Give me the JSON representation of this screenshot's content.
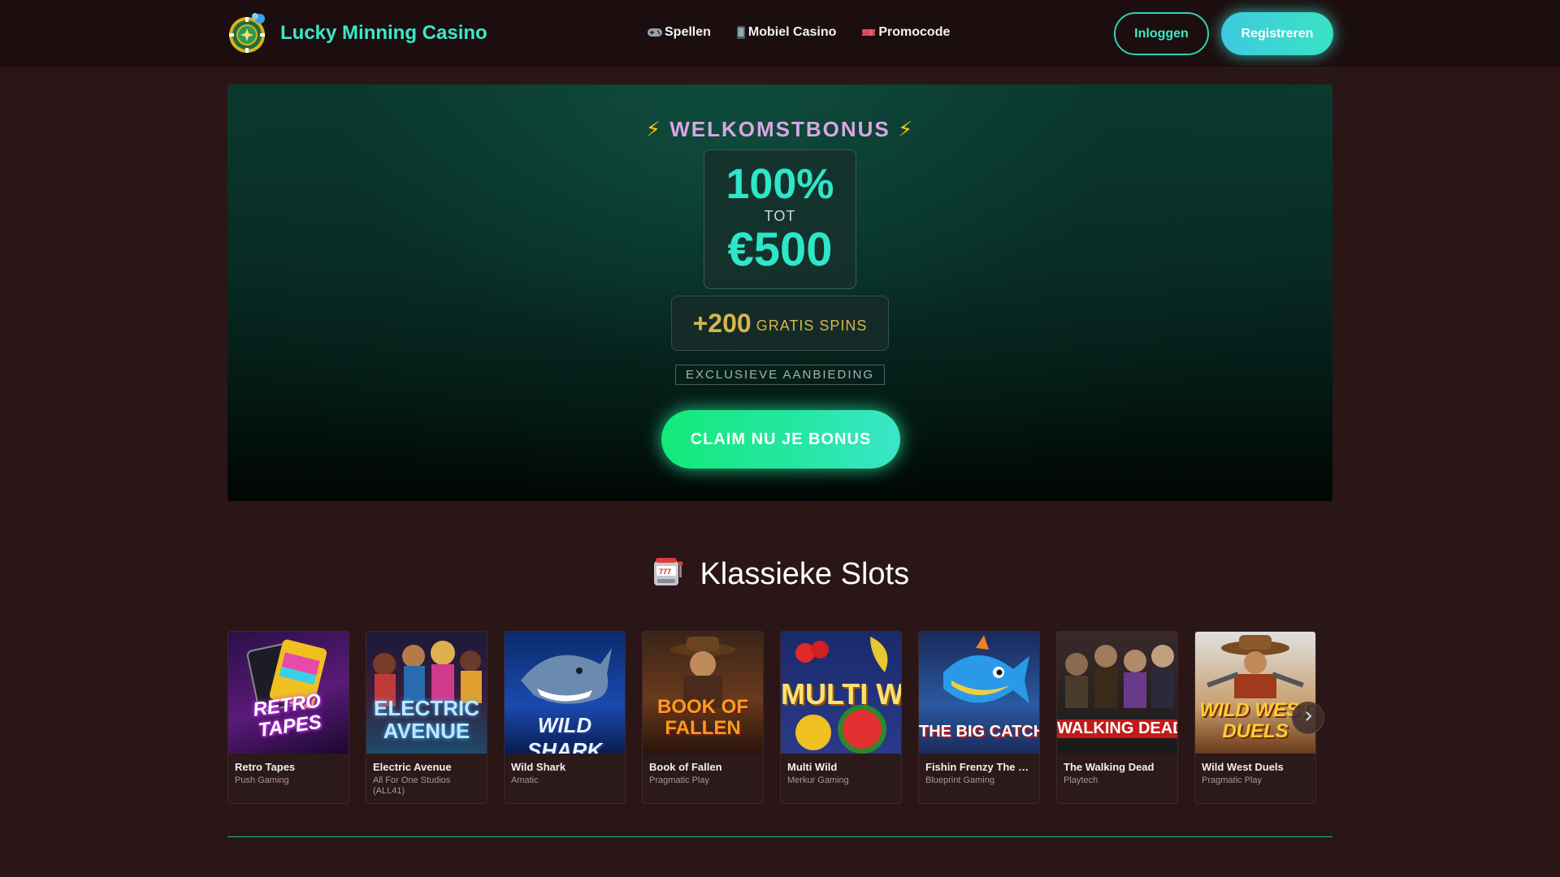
{
  "header": {
    "brand": "Lucky Minning Casino",
    "logo_icon": "casino-chip-logo",
    "nav": [
      {
        "label": "Spellen",
        "icon": "gamepad-icon"
      },
      {
        "label": "Mobiel Casino",
        "icon": "mobile-phone-icon"
      },
      {
        "label": "Promocode",
        "icon": "ticket-icon"
      }
    ],
    "login_label": "Inloggen",
    "register_label": "Registreren"
  },
  "hero": {
    "title": "WELKOMSTBONUS",
    "title_icon": "lightning-icon",
    "bonus_percent": "100%",
    "bonus_tot": "TOT",
    "bonus_amount": "€500",
    "spins_count": "+200",
    "spins_text": "GRATIS SPINS",
    "exclusive": "EXCLUSIEVE AANBIEDING",
    "claim_label": "CLAIM NU JE BONUS"
  },
  "slots": {
    "title": "Klassieke Slots",
    "title_icon": "slot-machine-icon",
    "games": [
      {
        "name": "Retro Tapes",
        "provider": "Push Gaming",
        "thumb_text": "RETRO TAPES"
      },
      {
        "name": "Electric Avenue",
        "provider": "All For One Studios (ALL41)",
        "thumb_text": "ELECTRIC AVENUE"
      },
      {
        "name": "Wild Shark",
        "provider": "Amatic",
        "thumb_text": "WILD SHARK"
      },
      {
        "name": "Book of Fallen",
        "provider": "Pragmatic Play",
        "thumb_text": "BOOK OF FALLEN"
      },
      {
        "name": "Multi Wild",
        "provider": "Merkur Gaming",
        "thumb_text": "MULTI WILD"
      },
      {
        "name": "Fishin Frenzy The Bi...",
        "provider": "Blueprint Gaming",
        "thumb_text": "THE BIG CATCH"
      },
      {
        "name": "The Walking Dead",
        "provider": "Playtech",
        "thumb_text": "WALKING DEAD"
      },
      {
        "name": "Wild West Duels",
        "provider": "Pragmatic Play",
        "thumb_text": "WILD WEST DUELS"
      }
    ],
    "next_icon": "chevron-right-icon"
  },
  "colors": {
    "accent": "#3be8c8",
    "background": "#2a1617",
    "header": "#1c0e0f",
    "claim_green": "#12ea78",
    "gold": "#d6b64a"
  }
}
